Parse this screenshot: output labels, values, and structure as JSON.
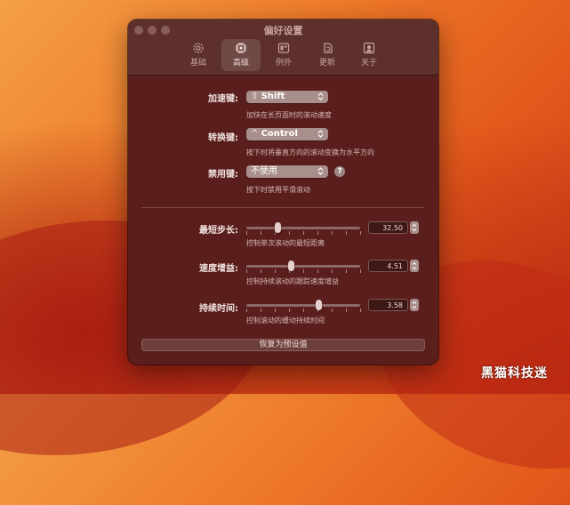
{
  "window": {
    "title": "偏好设置"
  },
  "tabs": [
    {
      "label": "基础",
      "icon": "gear-icon"
    },
    {
      "label": "高级",
      "icon": "chip-icon",
      "active": true
    },
    {
      "label": "例外",
      "icon": "window-icon"
    },
    {
      "label": "更新",
      "icon": "refresh-icon"
    },
    {
      "label": "关于",
      "icon": "person-icon"
    }
  ],
  "settings": {
    "accelerate": {
      "label": "加速键:",
      "symbol": "⇧",
      "value": "Shift",
      "hint": "加快在长页面时的滚动速度"
    },
    "convert": {
      "label": "转换键:",
      "symbol": "^",
      "value": "Control",
      "hint": "按下时将垂直方向的滚动变换为水平方向"
    },
    "disable": {
      "label": "禁用键:",
      "value": "不使用",
      "hint": "按下时禁用平滑滚动",
      "help": "?"
    }
  },
  "sliders": {
    "step": {
      "label": "最短步长:",
      "value": "32.50",
      "level": 0.27,
      "hint": "控制单次滚动的最短距离"
    },
    "gain": {
      "label": "速度增益:",
      "value": "4.51",
      "level": 0.39,
      "hint": "控制持续滚动的跟踪速度增益"
    },
    "duration": {
      "label": "持续时间:",
      "value": "3.58",
      "level": 0.63,
      "hint": "控制滚动的缓动持续时间"
    }
  },
  "reset_label": "恢复为预设值",
  "watermark": "黑猫科技迷",
  "colors": {
    "accent_active_tab": "#6a3b37",
    "window_bg": "#5a1f1d"
  }
}
